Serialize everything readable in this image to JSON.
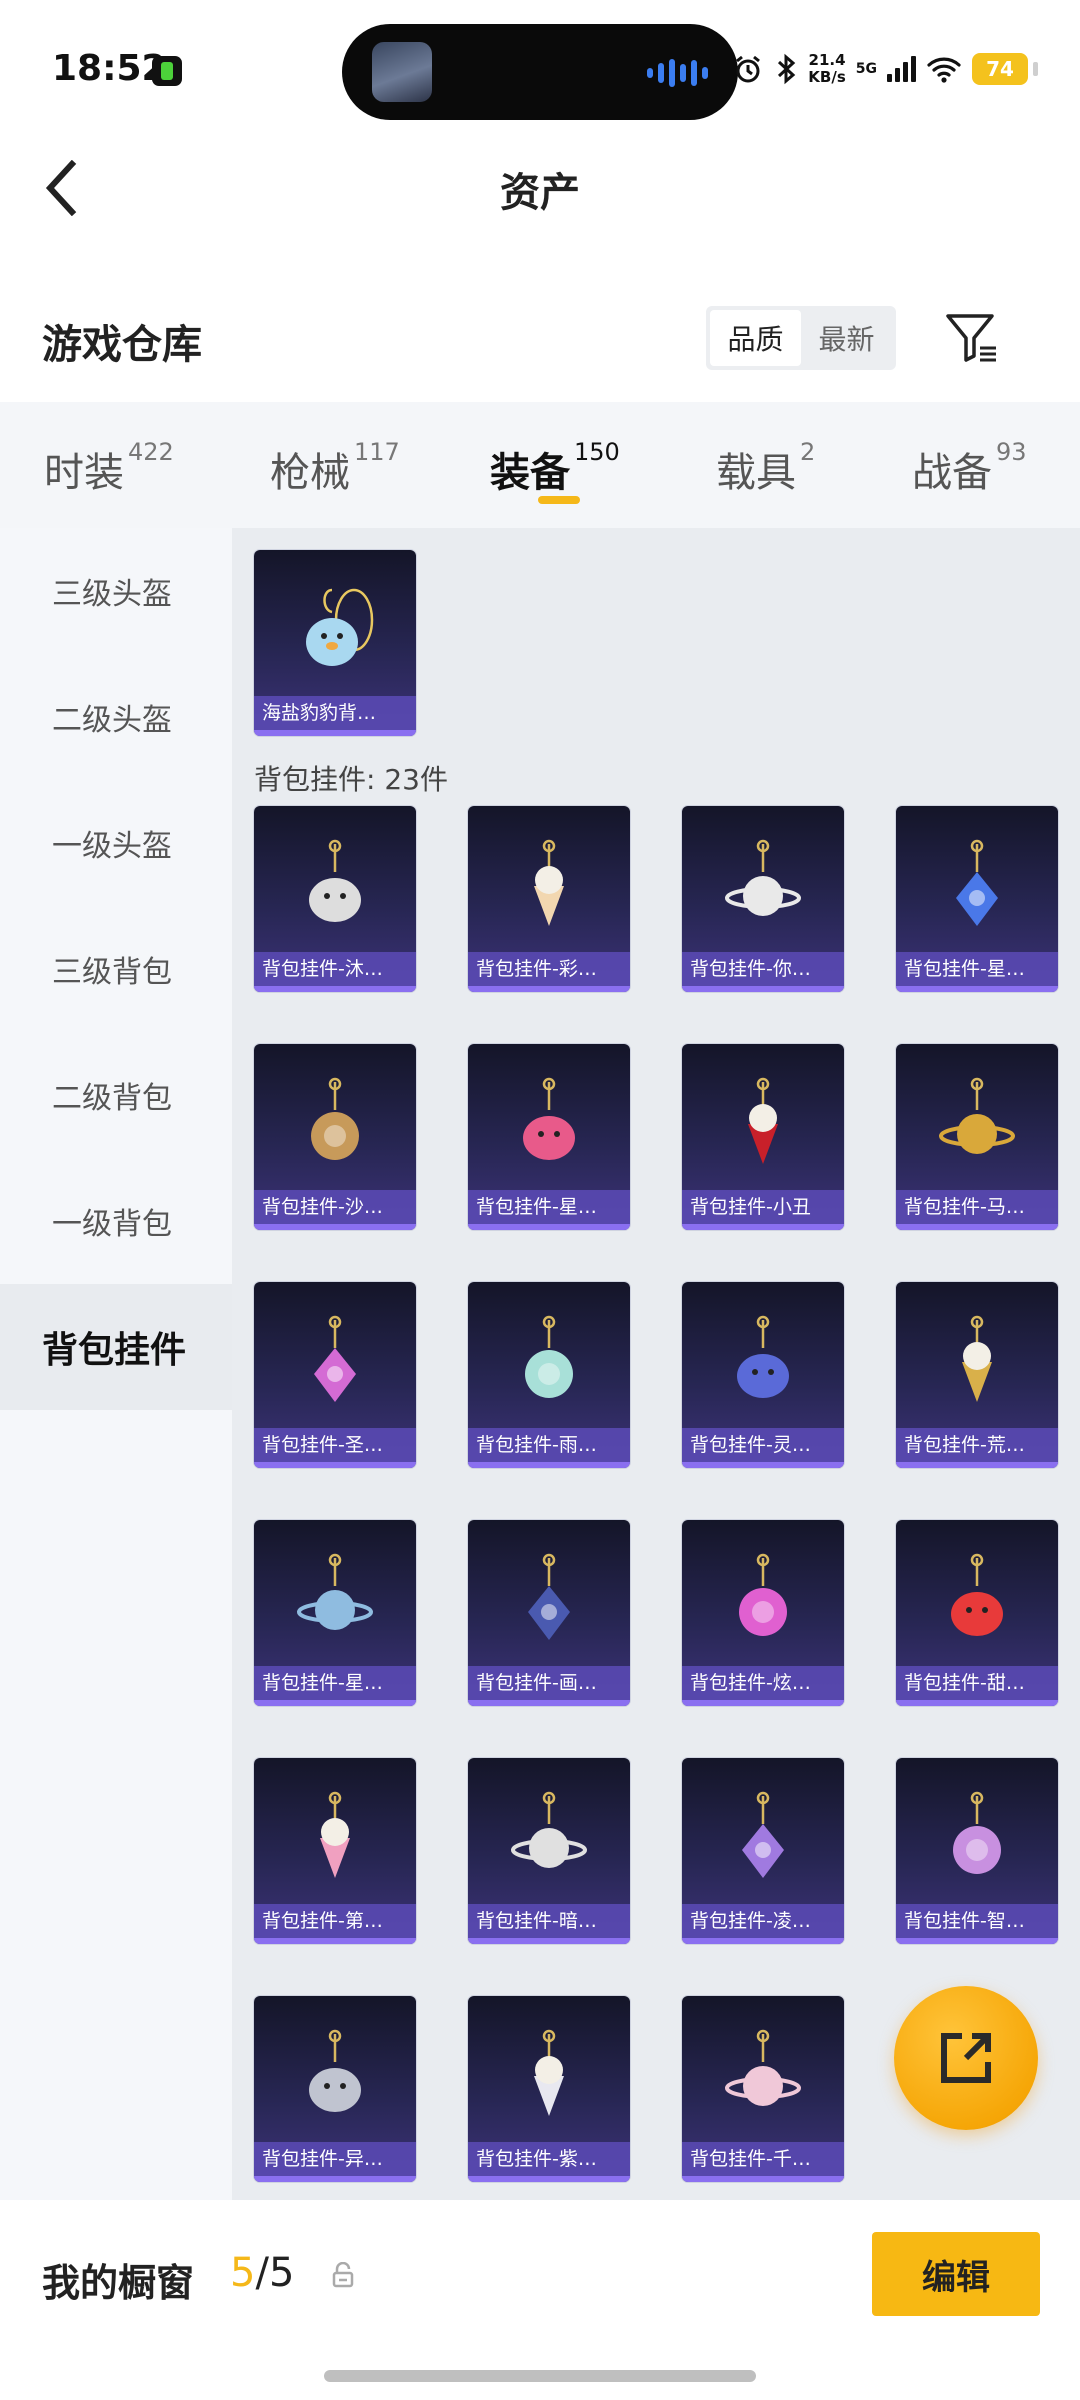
{
  "status_bar": {
    "time": "18:52",
    "net_speed_value": "21.4",
    "net_speed_unit": "KB/s",
    "network": "5G",
    "battery": "74"
  },
  "header": {
    "title": "资产"
  },
  "warehouse": {
    "title": "游戏仓库",
    "sort_options": [
      "品质",
      "最新"
    ],
    "active_sort": "品质"
  },
  "tabs": [
    {
      "label": "时装",
      "count": "422"
    },
    {
      "label": "枪械",
      "count": "117"
    },
    {
      "label": "装备",
      "count": "150",
      "active": true
    },
    {
      "label": "载具",
      "count": "2"
    },
    {
      "label": "战备",
      "count": "93"
    }
  ],
  "sidebar": {
    "items": [
      {
        "label": "三级头盔"
      },
      {
        "label": "二级头盔"
      },
      {
        "label": "一级头盔"
      },
      {
        "label": "三级背包"
      },
      {
        "label": "二级背包"
      },
      {
        "label": "一级背包"
      },
      {
        "label": "背包挂件",
        "active": true
      }
    ]
  },
  "content": {
    "featured": {
      "label": "海盐豹豹背…",
      "art": "seal-charm-icon",
      "color": "#a9d8f0"
    },
    "group_label": "背包挂件: 23件",
    "items": [
      {
        "label": "背包挂件-沐…",
        "art": "cat-charm-icon",
        "color": "#dddddd"
      },
      {
        "label": "背包挂件-彩…",
        "art": "icecream-charm-icon",
        "color": "#f2d7b0"
      },
      {
        "label": "背包挂件-你…",
        "art": "penguin-charm-icon",
        "color": "#e9e9e9"
      },
      {
        "label": "背包挂件-星…",
        "art": "planet-charm-icon",
        "color": "#4a78e8"
      },
      {
        "label": "背包挂件-沙…",
        "art": "gem-charm-icon",
        "color": "#c79a5a"
      },
      {
        "label": "背包挂件-星…",
        "art": "saturn-charm-icon",
        "color": "#e85a8a"
      },
      {
        "label": "背包挂件-小丑",
        "art": "lipstick-charm-icon",
        "color": "#c8202a"
      },
      {
        "label": "背包挂件-马…",
        "art": "horse-charm-icon",
        "color": "#d9a83a"
      },
      {
        "label": "背包挂件-圣…",
        "art": "orb-charm-icon",
        "color": "#d46bd4"
      },
      {
        "label": "背包挂件-雨…",
        "art": "wand-charm-icon",
        "color": "#a8e0d8"
      },
      {
        "label": "背包挂件-灵…",
        "art": "cat-bottle-charm-icon",
        "color": "#5a6ad8"
      },
      {
        "label": "背包挂件-荒…",
        "art": "sun-charm-icon",
        "color": "#d9b04a"
      },
      {
        "label": "背包挂件-星…",
        "art": "crystal-charm-icon",
        "color": "#8fbce0"
      },
      {
        "label": "背包挂件-画…",
        "art": "brush-charm-icon",
        "color": "#4a5ab0"
      },
      {
        "label": "背包挂件-炫…",
        "art": "candy-charm-icon",
        "color": "#e060d0"
      },
      {
        "label": "背包挂件-甜…",
        "art": "lollipop-charm-icon",
        "color": "#e83a3a"
      },
      {
        "label": "背包挂件-第…",
        "art": "heart-charm-icon",
        "color": "#f0a0c0"
      },
      {
        "label": "背包挂件-暗…",
        "art": "rabbit-charm-icon",
        "color": "#e0e0e0"
      },
      {
        "label": "背包挂件-凌…",
        "art": "swirl-charm-icon",
        "color": "#a07ae0"
      },
      {
        "label": "背包挂件-智…",
        "art": "star-charm-icon",
        "color": "#c890e0"
      },
      {
        "label": "背包挂件-异…",
        "art": "wings-charm-icon",
        "color": "#c0c4d0"
      },
      {
        "label": "背包挂件-紫…",
        "art": "bell-charm-icon",
        "color": "#e8e8f0"
      },
      {
        "label": "背包挂件-千…",
        "art": "kitty-charm-icon",
        "color": "#f0c8d8"
      }
    ]
  },
  "bottom_bar": {
    "showcase_label": "我的橱窗",
    "showcase_current": "5",
    "showcase_separator": "/",
    "showcase_total": "5",
    "edit_label": "编辑"
  },
  "colors": {
    "accent": "#f7b813",
    "card_bg": "#272653",
    "card_label": "#5a4ab4"
  }
}
